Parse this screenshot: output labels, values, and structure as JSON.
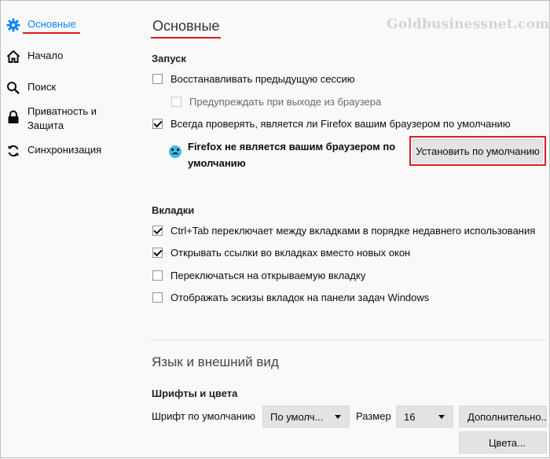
{
  "sidebar": {
    "items": [
      {
        "label": "Основные",
        "icon": "gear-icon",
        "active": true
      },
      {
        "label": "Начало",
        "icon": "home-icon"
      },
      {
        "label": "Поиск",
        "icon": "search-icon"
      },
      {
        "label": "Приватность и\nЗащита",
        "icon": "lock-icon"
      },
      {
        "label": "Синхронизация",
        "icon": "sync-icon"
      }
    ]
  },
  "watermark": "Goldbusinessnet.com",
  "page_title": "Основные",
  "startup": {
    "heading": "Запуск",
    "restore_session": {
      "label": "Восстанавливать предыдущую сессию",
      "checked": false
    },
    "warn_on_quit": {
      "label": "Предупреждать при выходе из браузера",
      "checked": false,
      "disabled": true
    },
    "check_default": {
      "label": "Всегда проверять, является ли Firefox вашим браузером по умолчанию",
      "checked": true
    },
    "not_default_msg": "Firefox не является вашим браузером по умолчанию",
    "set_default_button": "Установить по умолчанию"
  },
  "tabs": {
    "heading": "Вкладки",
    "options": [
      {
        "label": "Ctrl+Tab переключает между вкладками в порядке недавнего использования",
        "checked": true
      },
      {
        "label": "Открывать ссылки во вкладках вместо новых окон",
        "checked": true
      },
      {
        "label": "Переключаться на открываемую вкладку",
        "checked": false
      },
      {
        "label": "Отображать эскизы вкладок на панели задач Windows",
        "checked": false
      }
    ]
  },
  "appearance": {
    "section_title": "Язык и внешний вид",
    "fonts_heading": "Шрифты и цвета",
    "default_font_label": "Шрифт по умолчанию",
    "default_font_value": "По умолч...",
    "size_label": "Размер",
    "size_value": "16",
    "advanced_button": "Дополнительно...",
    "colors_button": "Цвета..."
  },
  "colors": {
    "accent": "#0a84ff",
    "highlight": "#e0141e"
  }
}
